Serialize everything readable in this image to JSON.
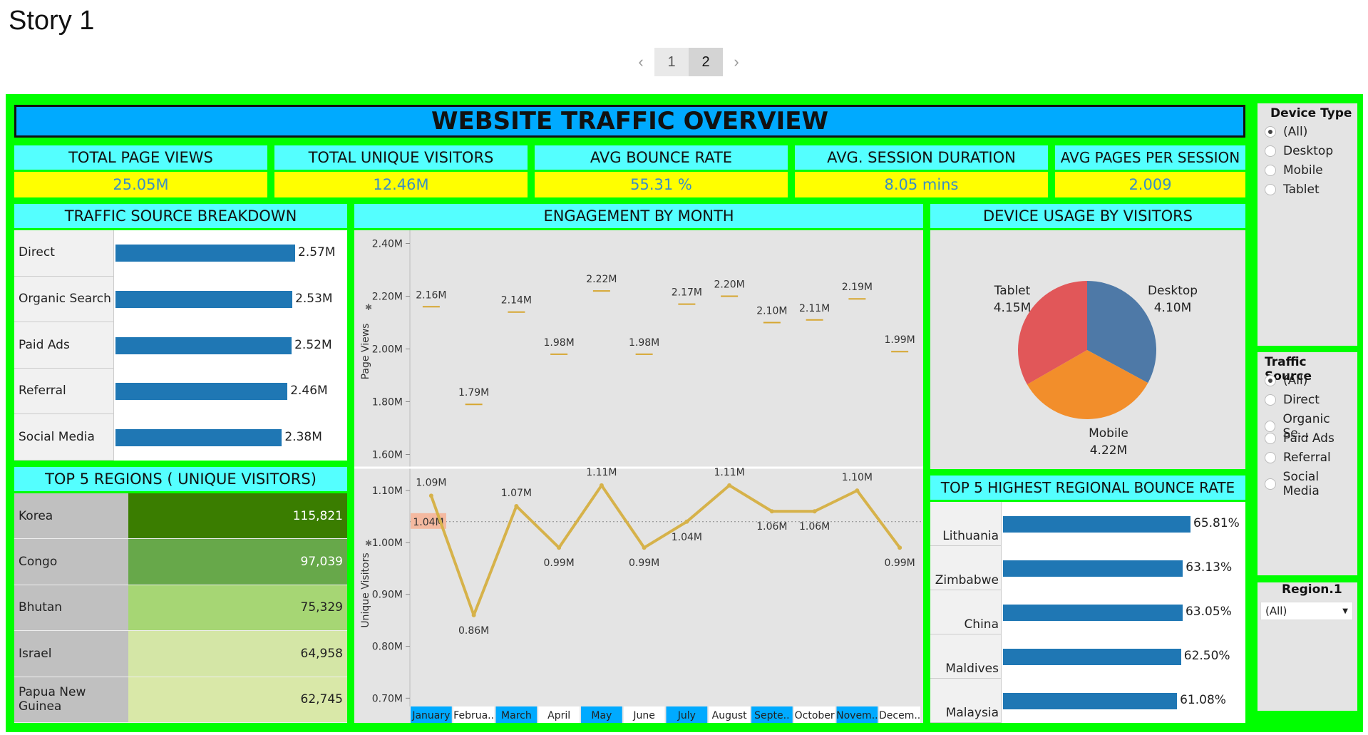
{
  "story": {
    "title": "Story 1",
    "pages": [
      "1",
      "2"
    ],
    "active_page": "2"
  },
  "dashboard": {
    "title": "WEBSITE TRAFFIC OVERVIEW"
  },
  "kpis": [
    {
      "label": "TOTAL PAGE VIEWS",
      "value": "25.05M"
    },
    {
      "label": "TOTAL UNIQUE VISITORS",
      "value": "12.46M"
    },
    {
      "label": "AVG BOUNCE RATE",
      "value": "55.31 %"
    },
    {
      "label": "AVG. SESSION DURATION",
      "value": "8.05 mins"
    },
    {
      "label": "AVG PAGES PER SESSION",
      "value": "2.009"
    }
  ],
  "traffic_source": {
    "title": "TRAFFIC SOURCE  BREAKDOWN",
    "rows": [
      {
        "label": "Direct",
        "value": 2.57,
        "text": "2.57M"
      },
      {
        "label": "Organic Search",
        "value": 2.53,
        "text": "2.53M"
      },
      {
        "label": "Paid Ads",
        "value": 2.52,
        "text": "2.52M"
      },
      {
        "label": "Referral",
        "value": 2.46,
        "text": "2.46M"
      },
      {
        "label": "Social Media",
        "value": 2.38,
        "text": "2.38M"
      }
    ]
  },
  "top_regions": {
    "title": "TOP 5 REGIONS ( UNIQUE VISITORS)",
    "rows": [
      {
        "label": "Korea",
        "value": "115,821",
        "color": "#3a7d00"
      },
      {
        "label": "Congo",
        "value": "97,039",
        "color": "#67a84a"
      },
      {
        "label": "Bhutan",
        "value": "75,329",
        "color": "#a6d674"
      },
      {
        "label": "Israel",
        "value": "64,958",
        "color": "#d4e6a6"
      },
      {
        "label": "Papua New Guinea",
        "value": "62,745",
        "color": "#d9e8a8"
      }
    ]
  },
  "engagement": {
    "title": "ENGAGEMENT BY MONTH",
    "months": [
      "January",
      "Februa..",
      "March",
      "April",
      "May",
      "June",
      "July",
      "August",
      "Septe..",
      "October",
      "Novem..",
      "Decem.."
    ],
    "highlight_months": [
      true,
      false,
      true,
      false,
      true,
      false,
      true,
      false,
      true,
      false,
      true,
      false
    ],
    "page_views": {
      "axis_label": "Page Views",
      "ticks": [
        "2.40M",
        "2.20M",
        "2.00M",
        "1.80M",
        "1.60M"
      ],
      "values": [
        2.16,
        1.79,
        2.14,
        1.98,
        2.22,
        1.98,
        2.17,
        2.2,
        2.1,
        2.11,
        2.19,
        1.99
      ],
      "labels": [
        "2.16M",
        "1.79M",
        "2.14M",
        "1.98M",
        "2.22M",
        "1.98M",
        "2.17M",
        "2.20M",
        "2.10M",
        "2.11M",
        "2.19M",
        "1.99M"
      ]
    },
    "unique_visitors": {
      "axis_label": "Unique Visitors",
      "ticks": [
        "1.10M",
        "1.00M",
        "0.90M",
        "0.80M",
        "0.70M"
      ],
      "values": [
        1.09,
        0.86,
        1.07,
        0.99,
        1.11,
        0.99,
        1.04,
        1.11,
        1.06,
        1.06,
        1.1,
        0.99
      ],
      "labels": [
        "1.09M",
        "0.86M",
        "1.07M",
        "0.99M",
        "1.11M",
        "0.99M",
        "1.04M",
        "1.11M",
        "1.06M",
        "1.06M",
        "1.10M",
        "0.99M"
      ],
      "reference_label": "1.04M",
      "reference_value": 1.04
    }
  },
  "device_usage": {
    "title": "DEVICE USAGE BY VISITORS",
    "slices": [
      {
        "name": "Desktop",
        "value": 4.1,
        "text": "4.10M",
        "color": "#4e79a7"
      },
      {
        "name": "Mobile",
        "value": 4.22,
        "text": "4.22M",
        "color": "#f28e2b"
      },
      {
        "name": "Tablet",
        "value": 4.15,
        "text": "4.15M",
        "color": "#e15759"
      }
    ]
  },
  "bounce_rate": {
    "title": "TOP 5  HIGHEST REGIONAL BOUNCE RATE",
    "rows": [
      {
        "label": "Lithuania",
        "value": 65.81,
        "text": "65.81%"
      },
      {
        "label": "Zimbabwe",
        "value": 63.13,
        "text": "63.13%"
      },
      {
        "label": "China",
        "value": 63.05,
        "text": "63.05%"
      },
      {
        "label": "Maldives",
        "value": 62.5,
        "text": "62.50%"
      },
      {
        "label": "Malaysia",
        "value": 61.08,
        "text": "61.08%"
      }
    ]
  },
  "filters": {
    "device_type": {
      "title": "Device Type",
      "options": [
        "(All)",
        "Desktop",
        "Mobile",
        "Tablet"
      ],
      "selected": "(All)"
    },
    "traffic_source": {
      "title": "Traffic Source",
      "options": [
        "(All)",
        "Direct",
        "Organic Se...",
        "Paid Ads",
        "Referral",
        "Social Media"
      ],
      "selected": "(All)"
    },
    "region": {
      "title": "Region.1",
      "selected": "(All)"
    }
  },
  "chart_data": [
    {
      "type": "bar",
      "title": "TRAFFIC SOURCE  BREAKDOWN",
      "categories": [
        "Direct",
        "Organic Search",
        "Paid Ads",
        "Referral",
        "Social Media"
      ],
      "values": [
        2.57,
        2.53,
        2.52,
        2.46,
        2.38
      ]
    },
    {
      "type": "table",
      "title": "TOP 5 REGIONS ( UNIQUE VISITORS)",
      "categories": [
        "Korea",
        "Congo",
        "Bhutan",
        "Israel",
        "Papua New Guinea"
      ],
      "values": [
        115821,
        97039,
        75329,
        64958,
        62745
      ]
    },
    {
      "type": "line",
      "title": "ENGAGEMENT BY MONTH",
      "categories": [
        "January",
        "Februa..",
        "March",
        "April",
        "May",
        "June",
        "July",
        "August",
        "Septe..",
        "October",
        "Novem..",
        "Decem.."
      ],
      "series": [
        {
          "name": "Page Views",
          "values": [
            2.16,
            1.79,
            2.14,
            1.98,
            2.22,
            1.98,
            2.17,
            2.2,
            2.1,
            2.11,
            2.19,
            1.99
          ]
        },
        {
          "name": "Unique Visitors",
          "values": [
            1.09,
            0.86,
            1.07,
            0.99,
            1.11,
            0.99,
            1.04,
            1.11,
            1.06,
            1.06,
            1.1,
            0.99
          ]
        }
      ],
      "ylim_page_views": [
        1.55,
        2.45
      ],
      "ylim_unique_visitors": [
        0.68,
        1.14
      ]
    },
    {
      "type": "pie",
      "title": "DEVICE USAGE BY VISITORS",
      "categories": [
        "Desktop",
        "Mobile",
        "Tablet"
      ],
      "values": [
        4.1,
        4.22,
        4.15
      ]
    },
    {
      "type": "bar",
      "title": "TOP 5  HIGHEST REGIONAL BOUNCE RATE",
      "categories": [
        "Lithuania",
        "Zimbabwe",
        "China",
        "Maldives",
        "Malaysia"
      ],
      "values": [
        65.81,
        63.13,
        63.05,
        62.5,
        61.08
      ]
    }
  ]
}
